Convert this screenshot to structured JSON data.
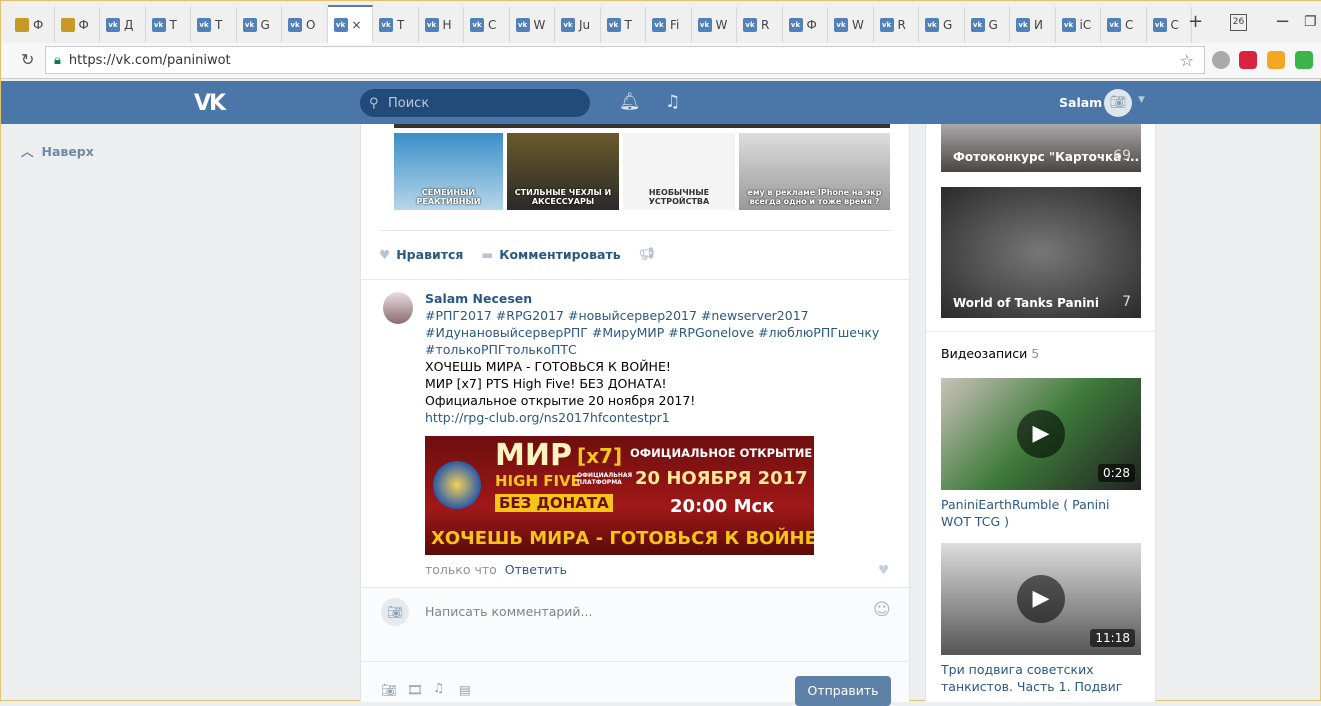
{
  "browser": {
    "tabs": [
      {
        "t": "Ф",
        "i": "gov"
      },
      {
        "t": "Ф",
        "i": "gov"
      },
      {
        "t": "Д"
      },
      {
        "t": "Т"
      },
      {
        "t": "Т"
      },
      {
        "t": "G"
      },
      {
        "t": "О"
      },
      {
        "t": "×",
        "active": true
      },
      {
        "t": "Т"
      },
      {
        "t": "Н"
      },
      {
        "t": "С"
      },
      {
        "t": "W"
      },
      {
        "t": "Ju"
      },
      {
        "t": "Т"
      },
      {
        "t": "Fi"
      },
      {
        "t": "W"
      },
      {
        "t": "R"
      },
      {
        "t": "Ф"
      },
      {
        "t": "W"
      },
      {
        "t": "R"
      },
      {
        "t": "G"
      },
      {
        "t": "G"
      },
      {
        "t": "И"
      },
      {
        "t": "iC"
      },
      {
        "t": "С"
      },
      {
        "t": "С"
      }
    ],
    "url": "https://vk.com/paniniwot",
    "calendar_badge": "26"
  },
  "header": {
    "logo": "VK",
    "search_placeholder": "Поиск",
    "user_name": "Salam"
  },
  "left": {
    "back_to_top": "Наверх"
  },
  "feed": {
    "photo_captions": [
      "СЕМЕЙНЫЙ РЕАКТИВНЫЙ",
      "СТИЛЬНЫЕ ЧЕХЛЫ И АКСЕССУАРЫ",
      "НЕОБЫЧНЫЕ УСТРОЙСТВА",
      "ему в рекламе IPhone на экр всегда одно и тоже время ?"
    ],
    "like_label": "Нравится",
    "comment_label": "Комментировать",
    "comment": {
      "author": "Salam Necesen",
      "hashtags": "#РПГ2017 #RPG2017 #новыйсервер2017 #newserver2017 #ИдунановыйсерверРПГ #МируМИР #RPGonelove #люблюРПГшечку #толькоРПГтолькоПТС",
      "lines": [
        "ХОЧЕШЬ МИРА - ГОТОВЬСЯ К ВОЙНЕ!",
        "МИР [x7] PTS High Five! БЕЗ ДОНАТА!",
        "Официальное открытие 20 ноября 2017!"
      ],
      "link": "http://rpg-club.org/ns2017hfcontestpr1",
      "banner": {
        "title": "МИР",
        "rate": "[x7]",
        "sub": "HIGH FIVE",
        "platform": "ОФИЦИАЛЬНАЯ ПЛАТФОРМА",
        "nodonate": "БЕЗ ДОНАТА",
        "open": "ОФИЦИАЛЬНОЕ ОТКРЫТИЕ",
        "date": "20 НОЯБРЯ 2017",
        "time": "20:00 Мск",
        "slogan": "ХОЧЕШЬ МИРА - ГОТОВЬСЯ К ВОЙНЕ"
      },
      "time": "только что",
      "reply": "Ответить"
    },
    "comment_placeholder": "Написать комментарий...",
    "send_label": "Отправить"
  },
  "sidebar": {
    "albums": [
      {
        "title": "Фотоконкурс \"Карточка ...",
        "count": "69"
      },
      {
        "title": "World of Tanks Panini",
        "count": "7"
      }
    ],
    "videos_label": "Видеозаписи",
    "videos_count": "5",
    "videos": [
      {
        "title": "PaniniEarthRumble ( Panini WOT TCG )",
        "duration": "0:28"
      },
      {
        "title": "Три подвига советских танкистов. Часть 1. Подвиг",
        "duration": "11:18"
      }
    ]
  }
}
